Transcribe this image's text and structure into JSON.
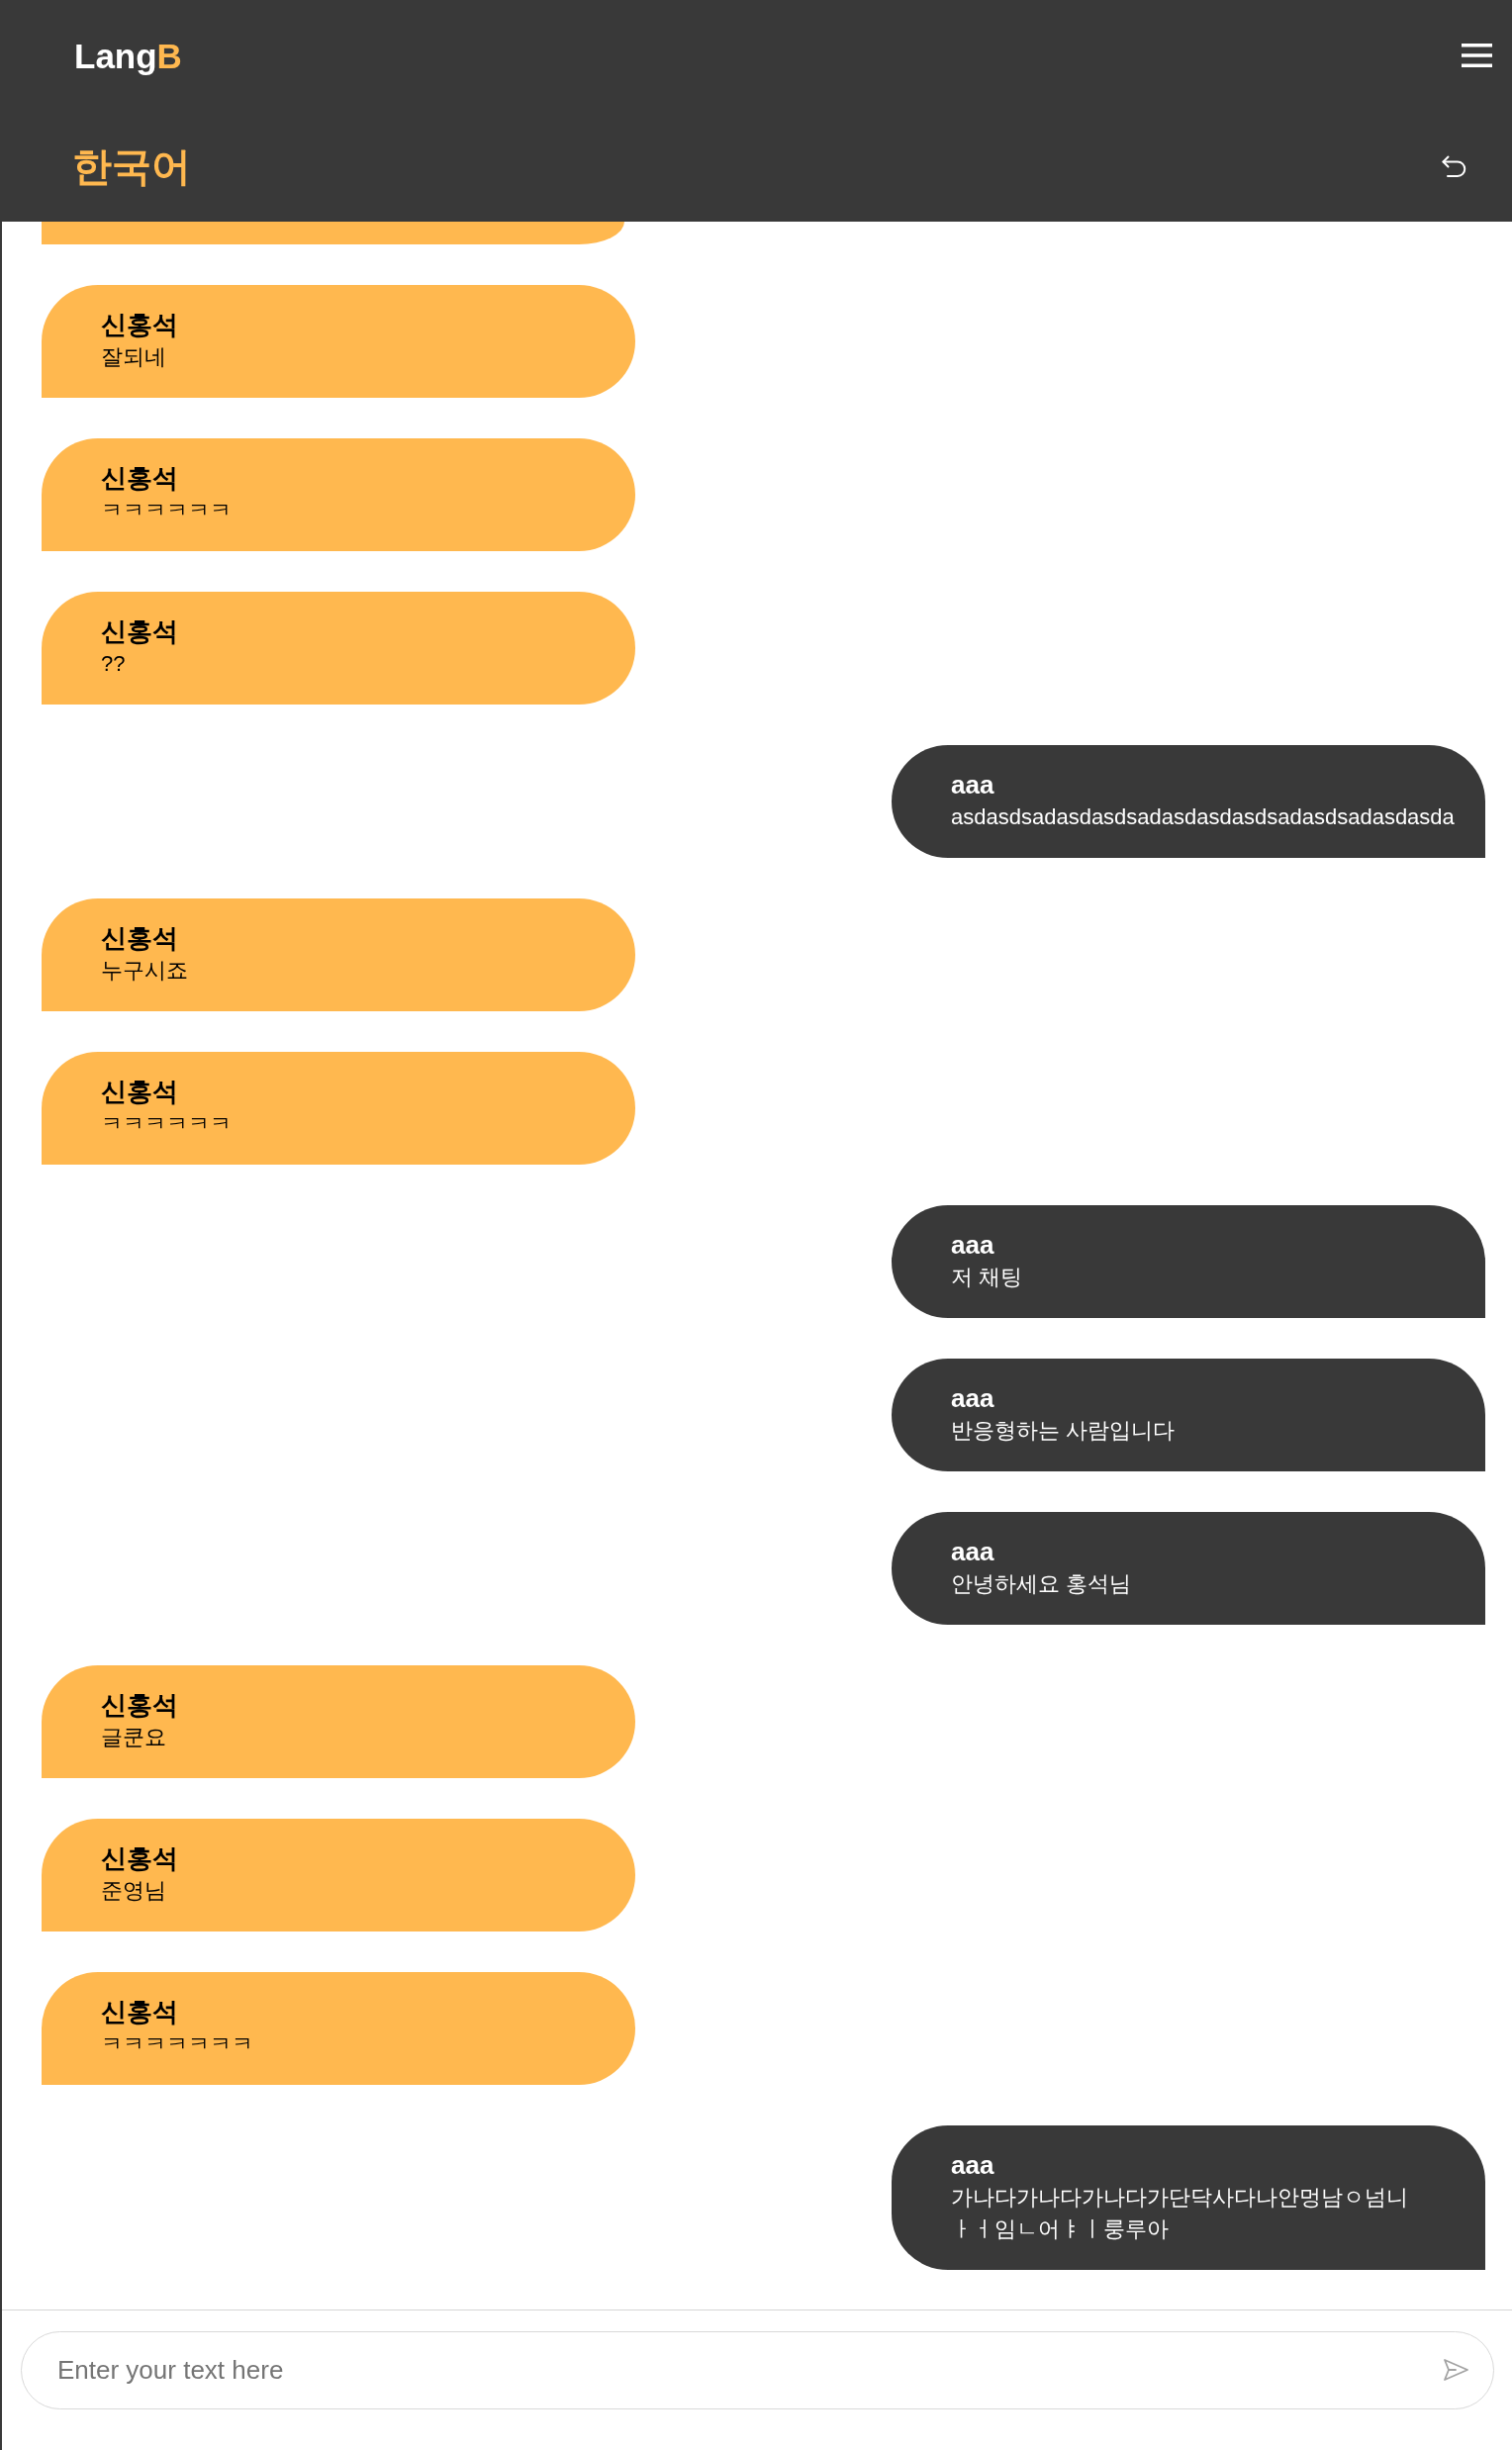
{
  "header": {
    "logo": {
      "text": "Lang",
      "highlight": "B"
    },
    "language": "한국어"
  },
  "messages": [
    {
      "kind": "partial",
      "outgoing": false
    },
    {
      "kind": "full",
      "outgoing": false,
      "sender": "신홍석",
      "text": "잘되네"
    },
    {
      "kind": "full",
      "outgoing": false,
      "sender": "신홍석",
      "text": "ㅋㅋㅋㅋㅋㅋ"
    },
    {
      "kind": "full",
      "outgoing": false,
      "sender": "신홍석",
      "text": "??"
    },
    {
      "kind": "full",
      "outgoing": true,
      "sender": "aaa",
      "text": "asdasdsadasdasdsadasdasdasdsadasdsadasdasda"
    },
    {
      "kind": "full",
      "outgoing": false,
      "sender": "신홍석",
      "text": "누구시죠"
    },
    {
      "kind": "full",
      "outgoing": false,
      "sender": "신홍석",
      "text": "ㅋㅋㅋㅋㅋㅋ"
    },
    {
      "kind": "full",
      "outgoing": true,
      "sender": "aaa",
      "text": "저 채팅"
    },
    {
      "kind": "full",
      "outgoing": true,
      "sender": "aaa",
      "text": "반응형하는 사람입니다"
    },
    {
      "kind": "full",
      "outgoing": true,
      "sender": "aaa",
      "text": "안녕하세요 홍석님"
    },
    {
      "kind": "full",
      "outgoing": false,
      "sender": "신홍석",
      "text": "글쿤요"
    },
    {
      "kind": "full",
      "outgoing": false,
      "sender": "신홍석",
      "text": "준영님"
    },
    {
      "kind": "full",
      "outgoing": false,
      "sender": "신홍석",
      "text": "ㅋㅋㅋㅋㅋㅋㅋ"
    },
    {
      "kind": "full",
      "outgoing": true,
      "sender": "aaa",
      "text": "가나다가나다가나다가단닥사다나안멍남ㅇ넘니ㅏㅓ임ㄴ어ㅑㅣ룽루아"
    }
  ],
  "composer": {
    "placeholder": "Enter your text here"
  }
}
